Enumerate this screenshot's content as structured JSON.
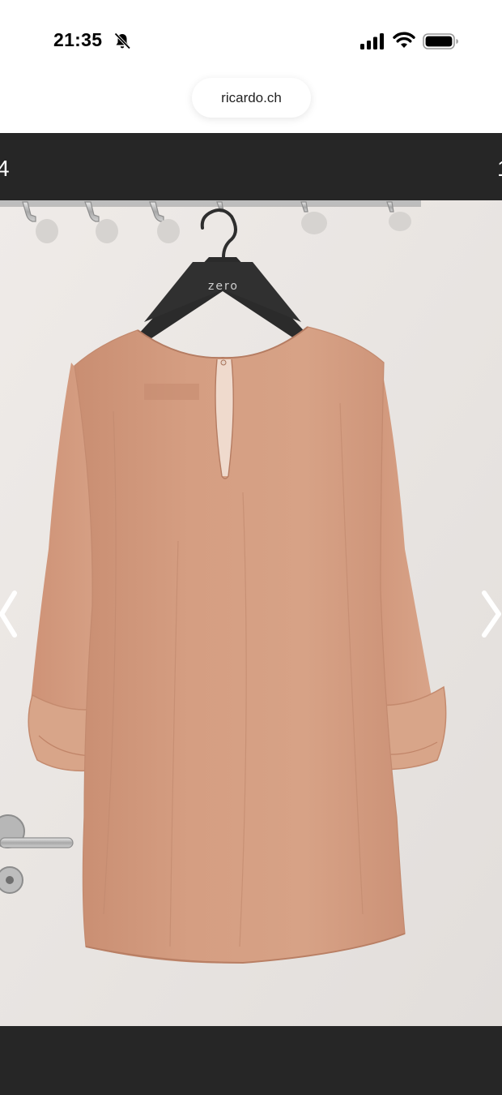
{
  "status_bar": {
    "time": "21:35",
    "icons": [
      "bell-slash-icon",
      "signal-icon",
      "wifi-icon",
      "battery-icon"
    ]
  },
  "browser": {
    "url": "ricardo.ch"
  },
  "gallery": {
    "counter_left": "4",
    "counter_right": "1",
    "photo": {
      "hanger_brand": "zero",
      "garment_color": "#D29A7E",
      "wall_color": "#E9E5E2"
    },
    "icons": [
      "chevron-left-icon",
      "chevron-right-icon"
    ]
  }
}
